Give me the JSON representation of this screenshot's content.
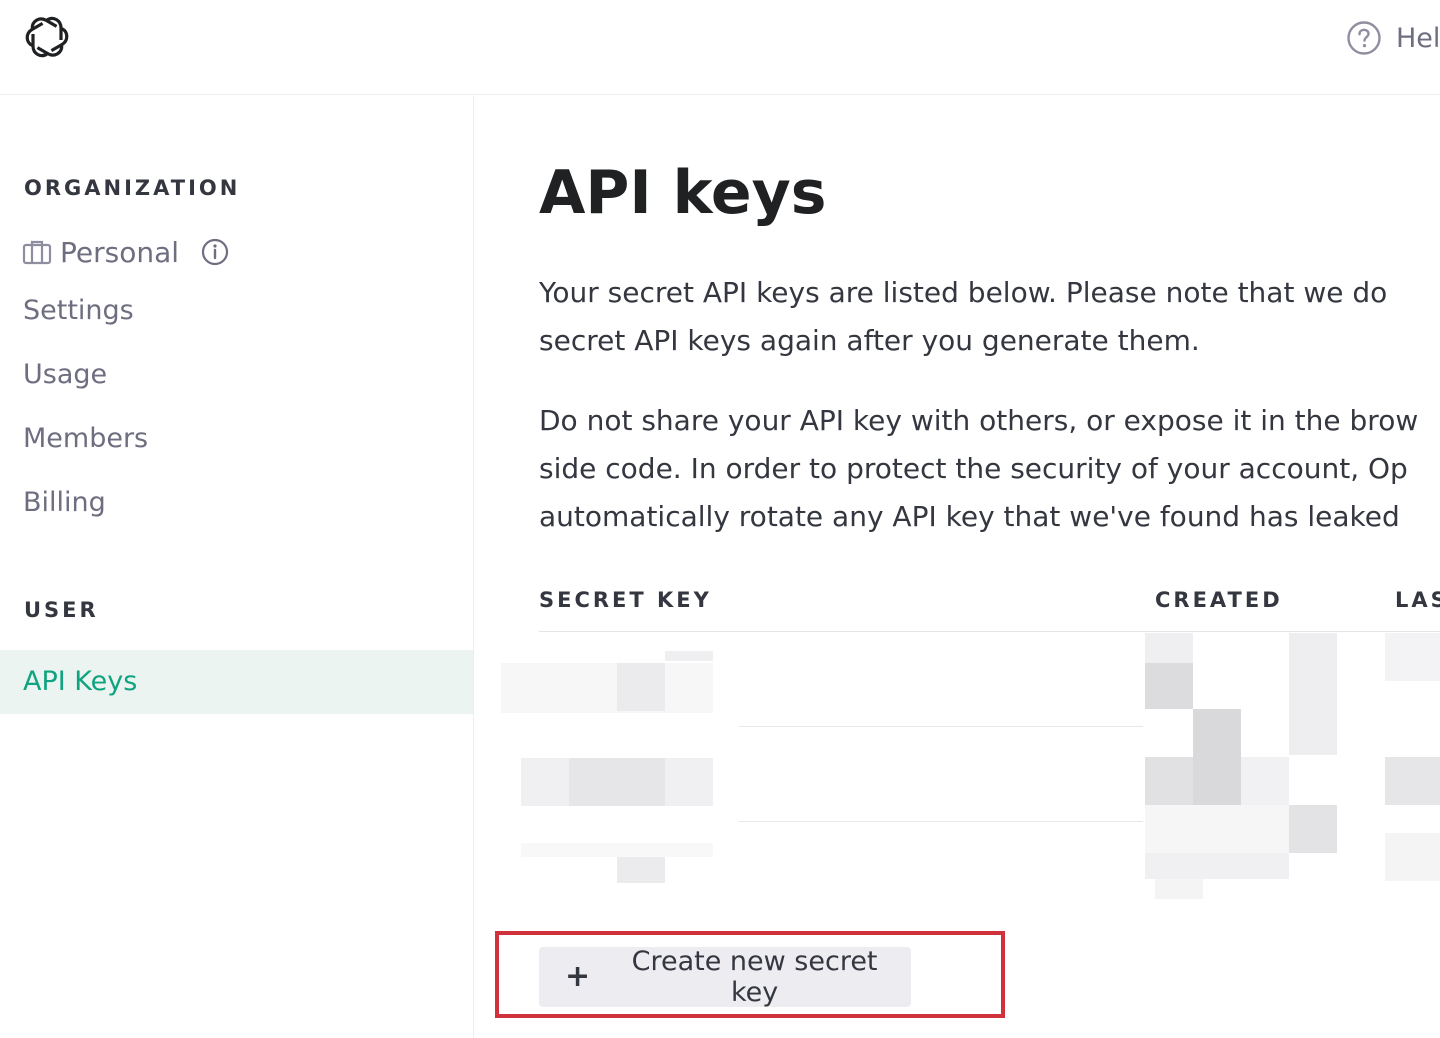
{
  "header": {
    "logo_icon": "openai-logo-icon",
    "help_label": "Help",
    "help_icon": "question-circle-icon"
  },
  "sidebar": {
    "organization_heading": "ORGANIZATION",
    "organization_name": "Personal",
    "organization_icon": "briefcase-icon",
    "organization_info_icon": "info-circle-icon",
    "org_items": [
      {
        "label": "Settings"
      },
      {
        "label": "Usage"
      },
      {
        "label": "Members"
      },
      {
        "label": "Billing"
      }
    ],
    "user_heading": "USER",
    "user_items": [
      {
        "label": "API Keys",
        "active": true
      }
    ]
  },
  "main": {
    "title": "API keys",
    "paragraph1": [
      "Your secret API keys are listed below. Please note that we do",
      "secret API keys again after you generate them."
    ],
    "paragraph2": [
      "Do not share your API key with others, or expose it in the brow",
      "side code. In order to protect the security of your account, Op",
      "automatically rotate any API key that we've found has leaked"
    ],
    "table": {
      "columns": [
        "SECRET KEY",
        "CREATED",
        "LAS"
      ],
      "rows_redacted": true
    },
    "create_button": {
      "icon": "plus-icon",
      "label": "Create new secret key",
      "highlighted": true
    }
  },
  "colors": {
    "accent": "#10a37f",
    "active_bg": "#ecf4f1",
    "highlight_border": "#d0313b",
    "button_bg": "#ececf1"
  }
}
